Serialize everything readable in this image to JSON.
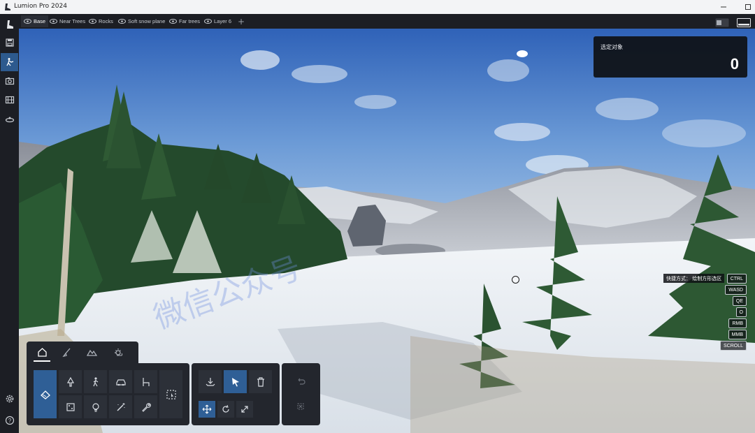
{
  "window": {
    "title": "Lumion Pro 2024",
    "controls": [
      "minimize-icon",
      "maximize-icon",
      "close-icon"
    ]
  },
  "sidebar": {
    "items": [
      {
        "name": "logo-icon",
        "active": false
      },
      {
        "name": "save-icon",
        "active": false
      },
      {
        "name": "build-mode-icon",
        "active": true
      },
      {
        "name": "photo-mode-icon",
        "active": false
      },
      {
        "name": "movie-mode-icon",
        "active": false
      },
      {
        "name": "panorama-mode-icon",
        "active": false
      }
    ],
    "bottom": [
      "settings-icon",
      "help-icon"
    ]
  },
  "layers": {
    "items": [
      {
        "label": "Base",
        "active": true
      },
      {
        "label": "Near Trees",
        "active": false
      },
      {
        "label": "Rocks",
        "active": false
      },
      {
        "label": "Soft snow plane",
        "active": false
      },
      {
        "label": "Far trees",
        "active": false
      },
      {
        "label": "Layer 6",
        "active": false
      }
    ],
    "add_label": "+"
  },
  "selection": {
    "label": "选定对象",
    "count": "0"
  },
  "shortcuts": {
    "title": "快捷方式：  绘制方形选区",
    "keys": [
      "CTRL",
      "WASD",
      "QE",
      "O",
      "RMB",
      "MMB",
      "SCROLL"
    ]
  },
  "toolbar": {
    "tabs": [
      "home-icon",
      "brush-icon",
      "landscape-icon",
      "weather-icon"
    ],
    "active_tab": "home-icon",
    "object_tools": [
      "nature-tree-icon",
      "people-icon",
      "vehicle-icon",
      "furniture-icon",
      "object-box-icon",
      "light-bulb-icon",
      "effects-wand-icon",
      "utility-wrench-icon"
    ],
    "edit_tools": [
      "place-object-icon",
      "select-cursor-icon",
      "delete-trash-icon"
    ],
    "transform_tools": [
      "move-icon",
      "rotate-icon",
      "scale-icon"
    ],
    "history_tools": [
      "undo-icon",
      "redo-icon"
    ]
  },
  "colors": {
    "accent": "#2f5f96",
    "panel": "#23262d",
    "sky_top": "#3a6fc4",
    "sky_bottom": "#a7c6e6",
    "snow": "#e8edf2"
  }
}
